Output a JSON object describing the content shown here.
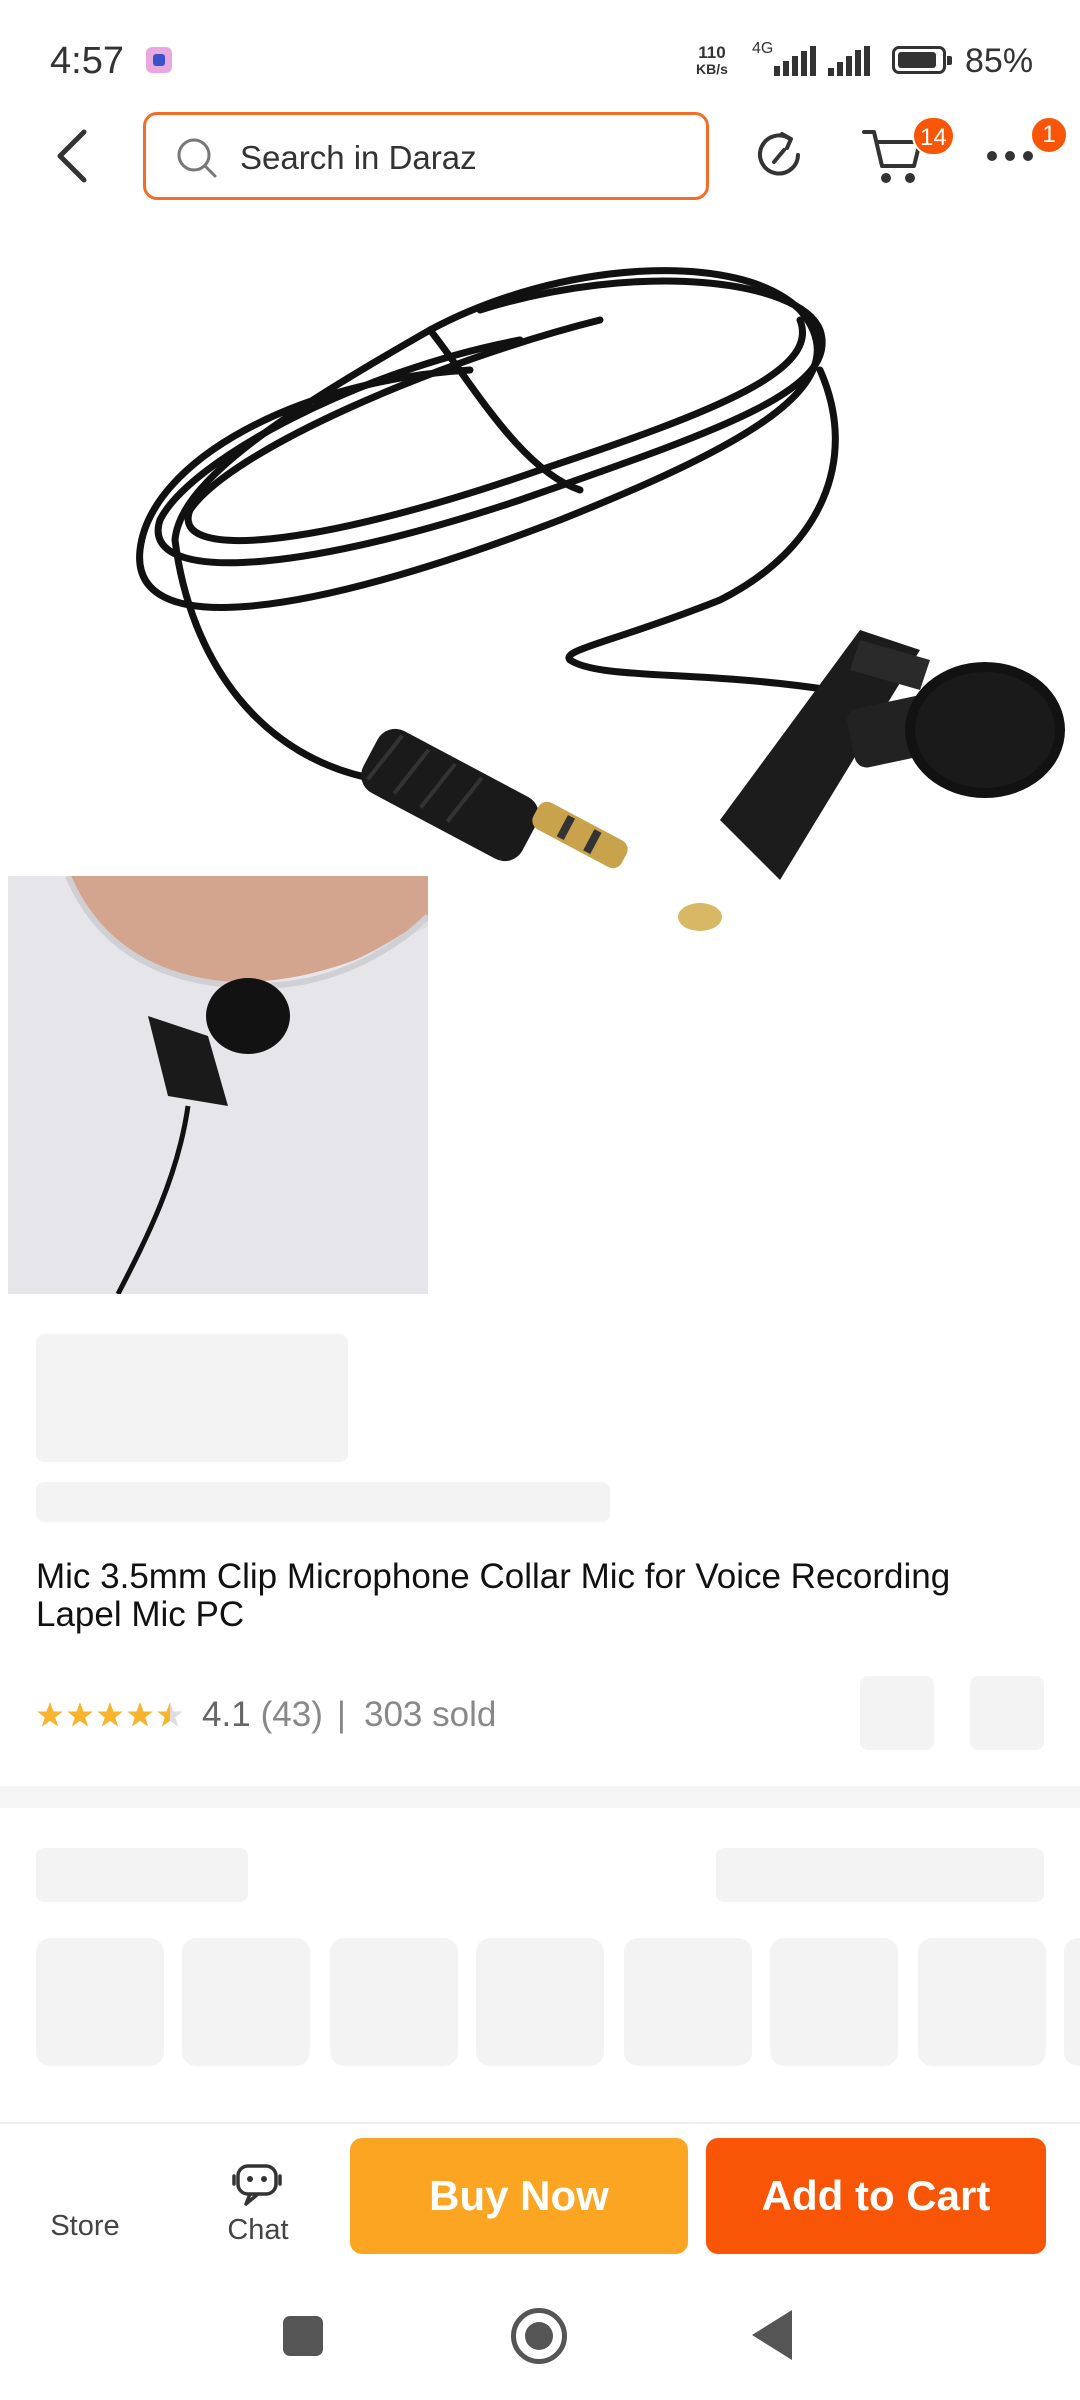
{
  "status_bar": {
    "time": "4:57",
    "speed_value": "110",
    "speed_unit": "KB/s",
    "network": "4G",
    "battery": "85%"
  },
  "header": {
    "search_placeholder": "Search in Daraz",
    "cart_count": "14",
    "more_count": "1"
  },
  "product": {
    "title": "Mic 3.5mm Clip Microphone Collar Mic for Voice Recording Lapel Mic PC",
    "rating": "4.1",
    "rating_count": "(43)",
    "separator": "|",
    "sold": "303 sold",
    "stars_filled": 4.1,
    "star_color": "#f8b42d"
  },
  "action_bar": {
    "store_label": "Store",
    "chat_label": "Chat",
    "buy_now_label": "Buy Now",
    "add_to_cart_label": "Add to Cart"
  },
  "colors": {
    "brand_orange": "#f85606",
    "buy_now_yellow": "#fca522"
  }
}
